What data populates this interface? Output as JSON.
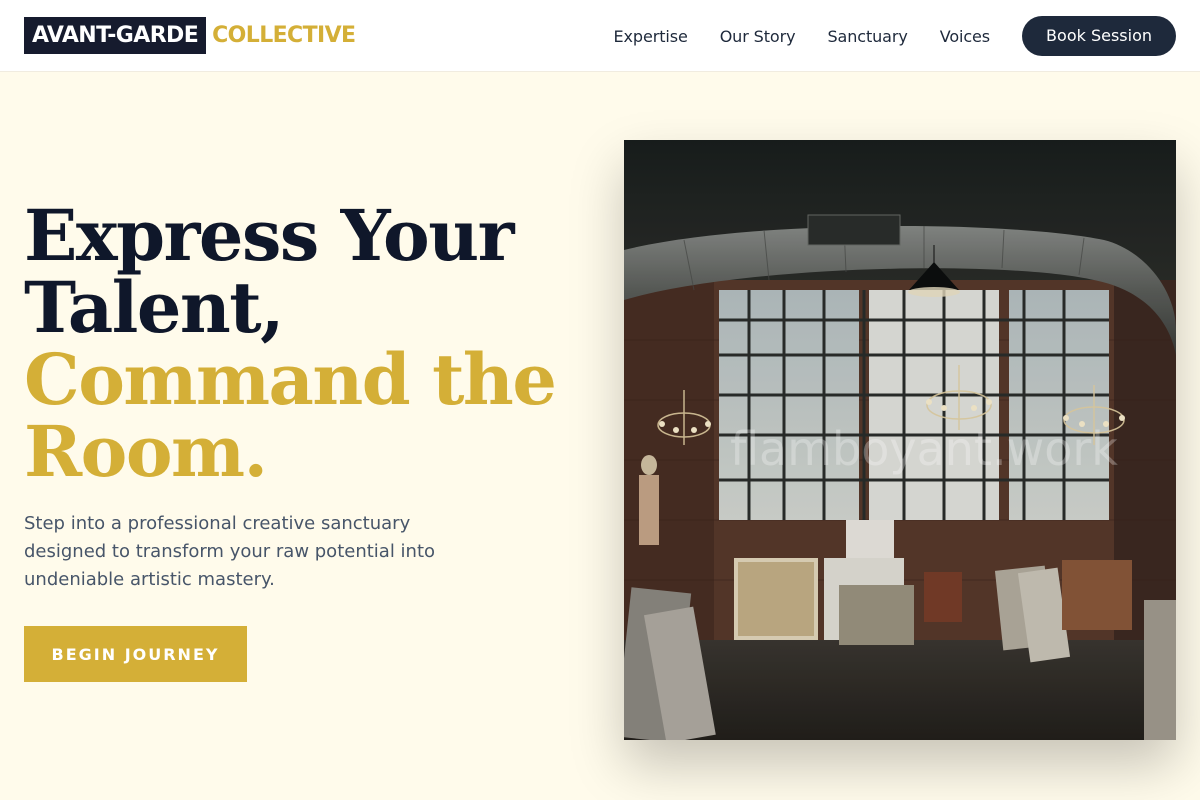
{
  "brand": {
    "name_dark": "AVANT-GARDE",
    "name_accent": "COLLECTIVE"
  },
  "nav": {
    "links": [
      "Expertise",
      "Our Story",
      "Sanctuary",
      "Voices"
    ],
    "cta_label": "Book Session"
  },
  "hero": {
    "headline_line1": "Express Your",
    "headline_line2": "Talent,",
    "headline_accent_line1": "Command the",
    "headline_accent_line2": "Room.",
    "description": "Step into a professional creative sanctuary designed to transform your raw potential into undeniable artistic mastery.",
    "cta_label": "BEGIN JOURNEY",
    "image_watermark": "flamboyant.work"
  },
  "colors": {
    "navy": "#161b2e",
    "gold": "#d4af37",
    "cream": "#fffbeb",
    "button_dark": "#1e293b"
  }
}
